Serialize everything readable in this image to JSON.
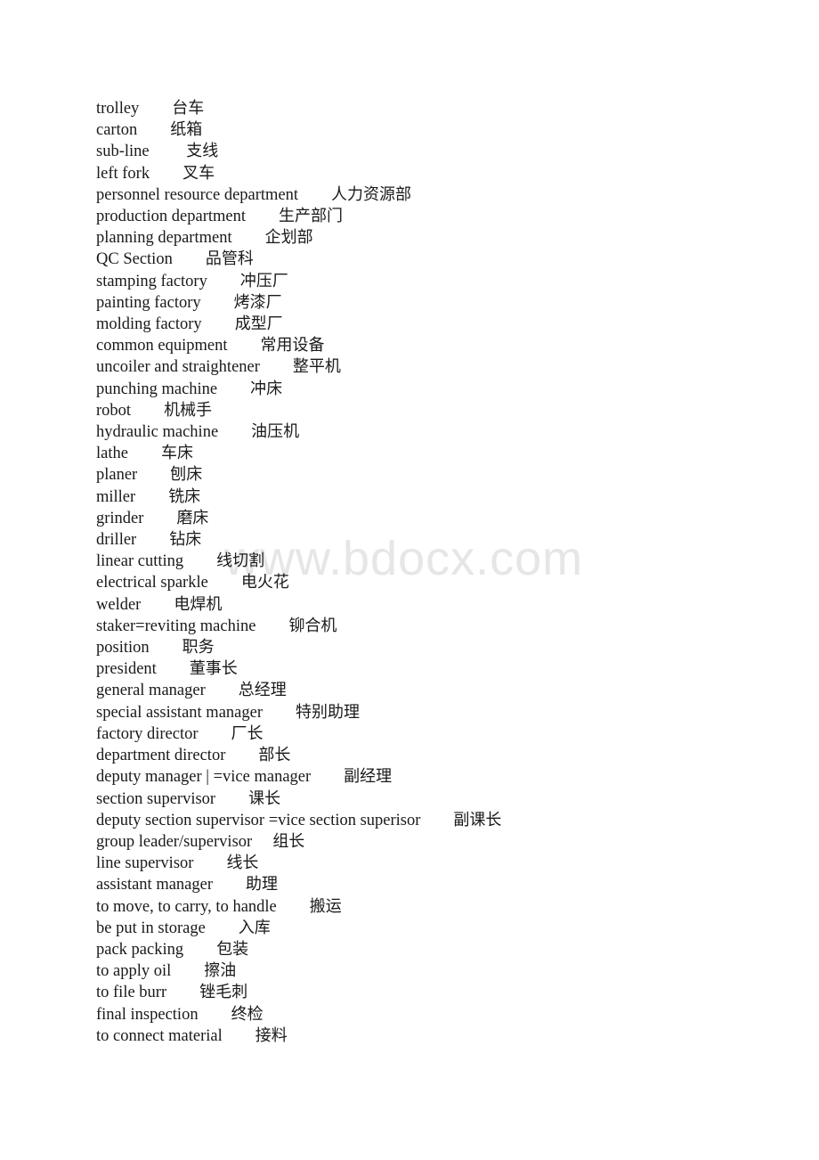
{
  "document": {
    "type": "bilingual-glossary",
    "background_color": "#ffffff",
    "text_color": "#1a1a1a"
  },
  "watermark": {
    "text": "www.bdocx.com",
    "color": "#e6e6e6"
  },
  "glossary": {
    "entries": [
      {
        "en": "trolley",
        "gap": "        ",
        "zh": "台车"
      },
      {
        "en": "carton",
        "gap": "        ",
        "zh": "纸箱"
      },
      {
        "en": "sub-line",
        "gap": "         ",
        "zh": "支线"
      },
      {
        "en": "left fork",
        "gap": "        ",
        "zh": "叉车"
      },
      {
        "en": "personnel resource department",
        "gap": "        ",
        "zh": "人力资源部"
      },
      {
        "en": "production department",
        "gap": "        ",
        "zh": "生产部门"
      },
      {
        "en": "planning department",
        "gap": "        ",
        "zh": "企划部"
      },
      {
        "en": "QC Section",
        "gap": "        ",
        "zh": "品管科"
      },
      {
        "en": "stamping factory",
        "gap": "        ",
        "zh": "冲压厂"
      },
      {
        "en": "painting factory",
        "gap": "        ",
        "zh": "烤漆厂"
      },
      {
        "en": "molding factory",
        "gap": "        ",
        "zh": "成型厂"
      },
      {
        "en": "common equipment",
        "gap": "        ",
        "zh": "常用设备"
      },
      {
        "en": "uncoiler and straightener",
        "gap": "        ",
        "zh": "整平机"
      },
      {
        "en": "punching machine",
        "gap": "        ",
        "zh": "冲床"
      },
      {
        "en": "robot",
        "gap": "        ",
        "zh": "机械手"
      },
      {
        "en": "hydraulic machine",
        "gap": "        ",
        "zh": "油压机"
      },
      {
        "en": "lathe",
        "gap": "        ",
        "zh": "车床"
      },
      {
        "en": "planer",
        "gap": "        ",
        "zh": "刨床"
      },
      {
        "en": "miller",
        "gap": "        ",
        "zh": "铣床"
      },
      {
        "en": "grinder",
        "gap": "        ",
        "zh": "磨床"
      },
      {
        "en": "driller",
        "gap": "        ",
        "zh": "钻床"
      },
      {
        "en": "linear cutting",
        "gap": "        ",
        "zh": "线切割"
      },
      {
        "en": "electrical sparkle",
        "gap": "        ",
        "zh": "电火花"
      },
      {
        "en": "welder",
        "gap": "        ",
        "zh": "电焊机"
      },
      {
        "en": "staker=reviting machine",
        "gap": "        ",
        "zh": "铆合机"
      },
      {
        "en": "position",
        "gap": "        ",
        "zh": "职务"
      },
      {
        "en": "president",
        "gap": "        ",
        "zh": "董事长"
      },
      {
        "en": "general manager",
        "gap": "        ",
        "zh": "总经理"
      },
      {
        "en": "special assistant manager",
        "gap": "        ",
        "zh": "特别助理"
      },
      {
        "en": "factory director",
        "gap": "        ",
        "zh": "厂长"
      },
      {
        "en": "department director",
        "gap": "        ",
        "zh": "部长"
      },
      {
        "en": "deputy manager | =vice manager",
        "gap": "        ",
        "zh": "副经理"
      },
      {
        "en": "section supervisor",
        "gap": "        ",
        "zh": "课长"
      },
      {
        "en": "deputy section supervisor =vice section superisor",
        "gap": "        ",
        "zh": "副课长"
      },
      {
        "en": "group leader/supervisor",
        "gap": "     ",
        "zh": "组长"
      },
      {
        "en": "line supervisor",
        "gap": "        ",
        "zh": "线长"
      },
      {
        "en": "assistant manager",
        "gap": "        ",
        "zh": "助理"
      },
      {
        "en": "to move, to carry, to handle",
        "gap": "        ",
        "zh": "搬运"
      },
      {
        "en": "be put in storage",
        "gap": "        ",
        "zh": "入库"
      },
      {
        "en": "pack packing",
        "gap": "        ",
        "zh": "包装"
      },
      {
        "en": "to apply oil",
        "gap": "        ",
        "zh": "擦油"
      },
      {
        "en": "to file burr",
        "gap": "        ",
        "zh": "锉毛刺"
      },
      {
        "en": "final inspection",
        "gap": "        ",
        "zh": "终检"
      },
      {
        "en": "to connect material",
        "gap": "        ",
        "zh": "接料"
      }
    ]
  }
}
